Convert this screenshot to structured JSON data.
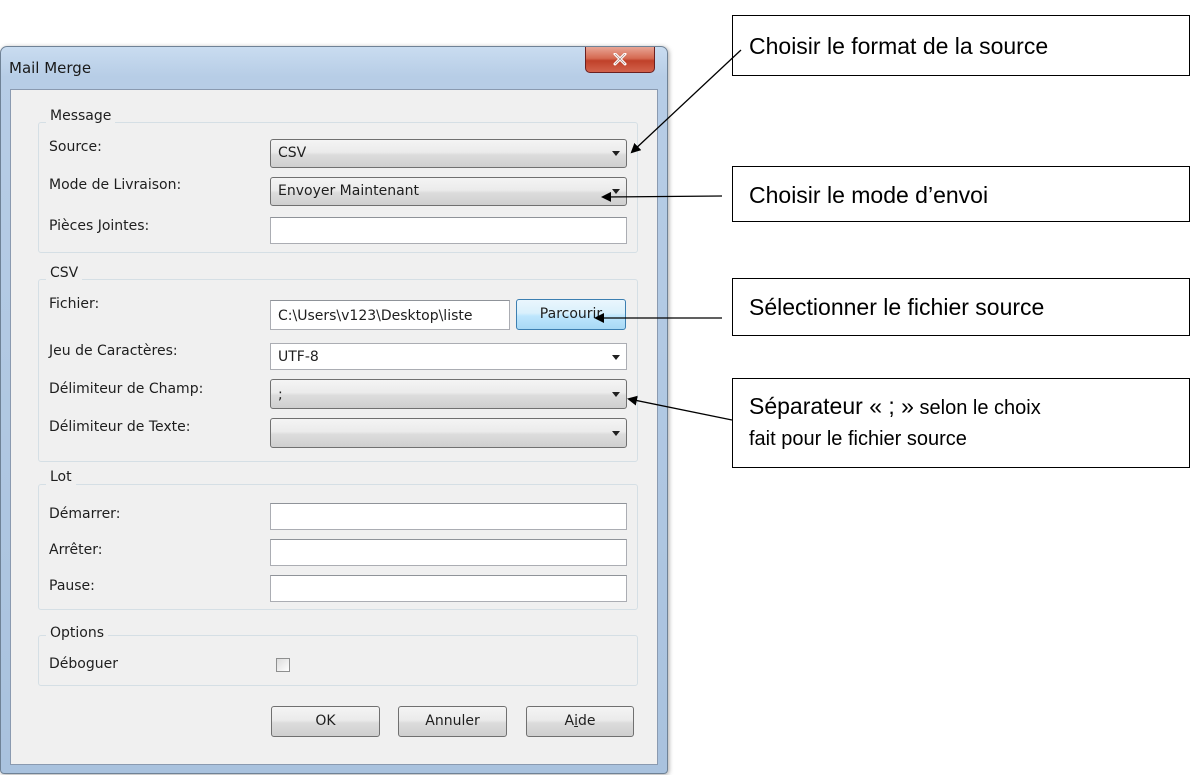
{
  "window": {
    "title": "Mail Merge"
  },
  "message_group": {
    "legend": "Message",
    "source_label": "Source:",
    "source_value": "CSV",
    "delivery_label": "Mode de Livraison:",
    "delivery_value": "Envoyer Maintenant",
    "attachments_label": "Pièces Jointes:",
    "attachments_value": ""
  },
  "csv_group": {
    "legend": "CSV",
    "file_label": "Fichier:",
    "file_value": "C:\\Users\\v123\\Desktop\\liste",
    "browse_label": "Parcourir",
    "charset_label": "Jeu de Caractères:",
    "charset_value": "UTF-8",
    "field_delim_label": "Délimiteur de Champ:",
    "field_delim_value": ";",
    "text_delim_label": "Délimiteur de Texte:",
    "text_delim_value": ""
  },
  "batch_group": {
    "legend": "Lot",
    "start_label": "Démarrer:",
    "stop_label": "Arrêter:",
    "pause_label": "Pause:",
    "start_value": "",
    "stop_value": "",
    "pause_value": ""
  },
  "options_group": {
    "legend": "Options",
    "debug_label": "Déboguer",
    "debug_checked": false
  },
  "buttons": {
    "ok": "OK",
    "cancel": "Annuler",
    "help_prefix": "A",
    "help_mnemonic": "i",
    "help_suffix": "de"
  },
  "callouts": {
    "format": "Choisir le format de la source",
    "mode": "Choisir le mode d’envoi",
    "file": "Sélectionner le fichier source",
    "separator_part1": "Séparateur « ; »",
    "separator_part2": " selon le choix",
    "separator_line2": "fait pour le fichier source"
  },
  "icons": {
    "close": "close-icon",
    "dropdown": "chevron-down-icon"
  },
  "colors": {
    "titlebar": "#b7cde6",
    "close_button": "#c9513a",
    "focus_button": "#bee6fd",
    "dialog_bg": "#f0f0f0"
  }
}
